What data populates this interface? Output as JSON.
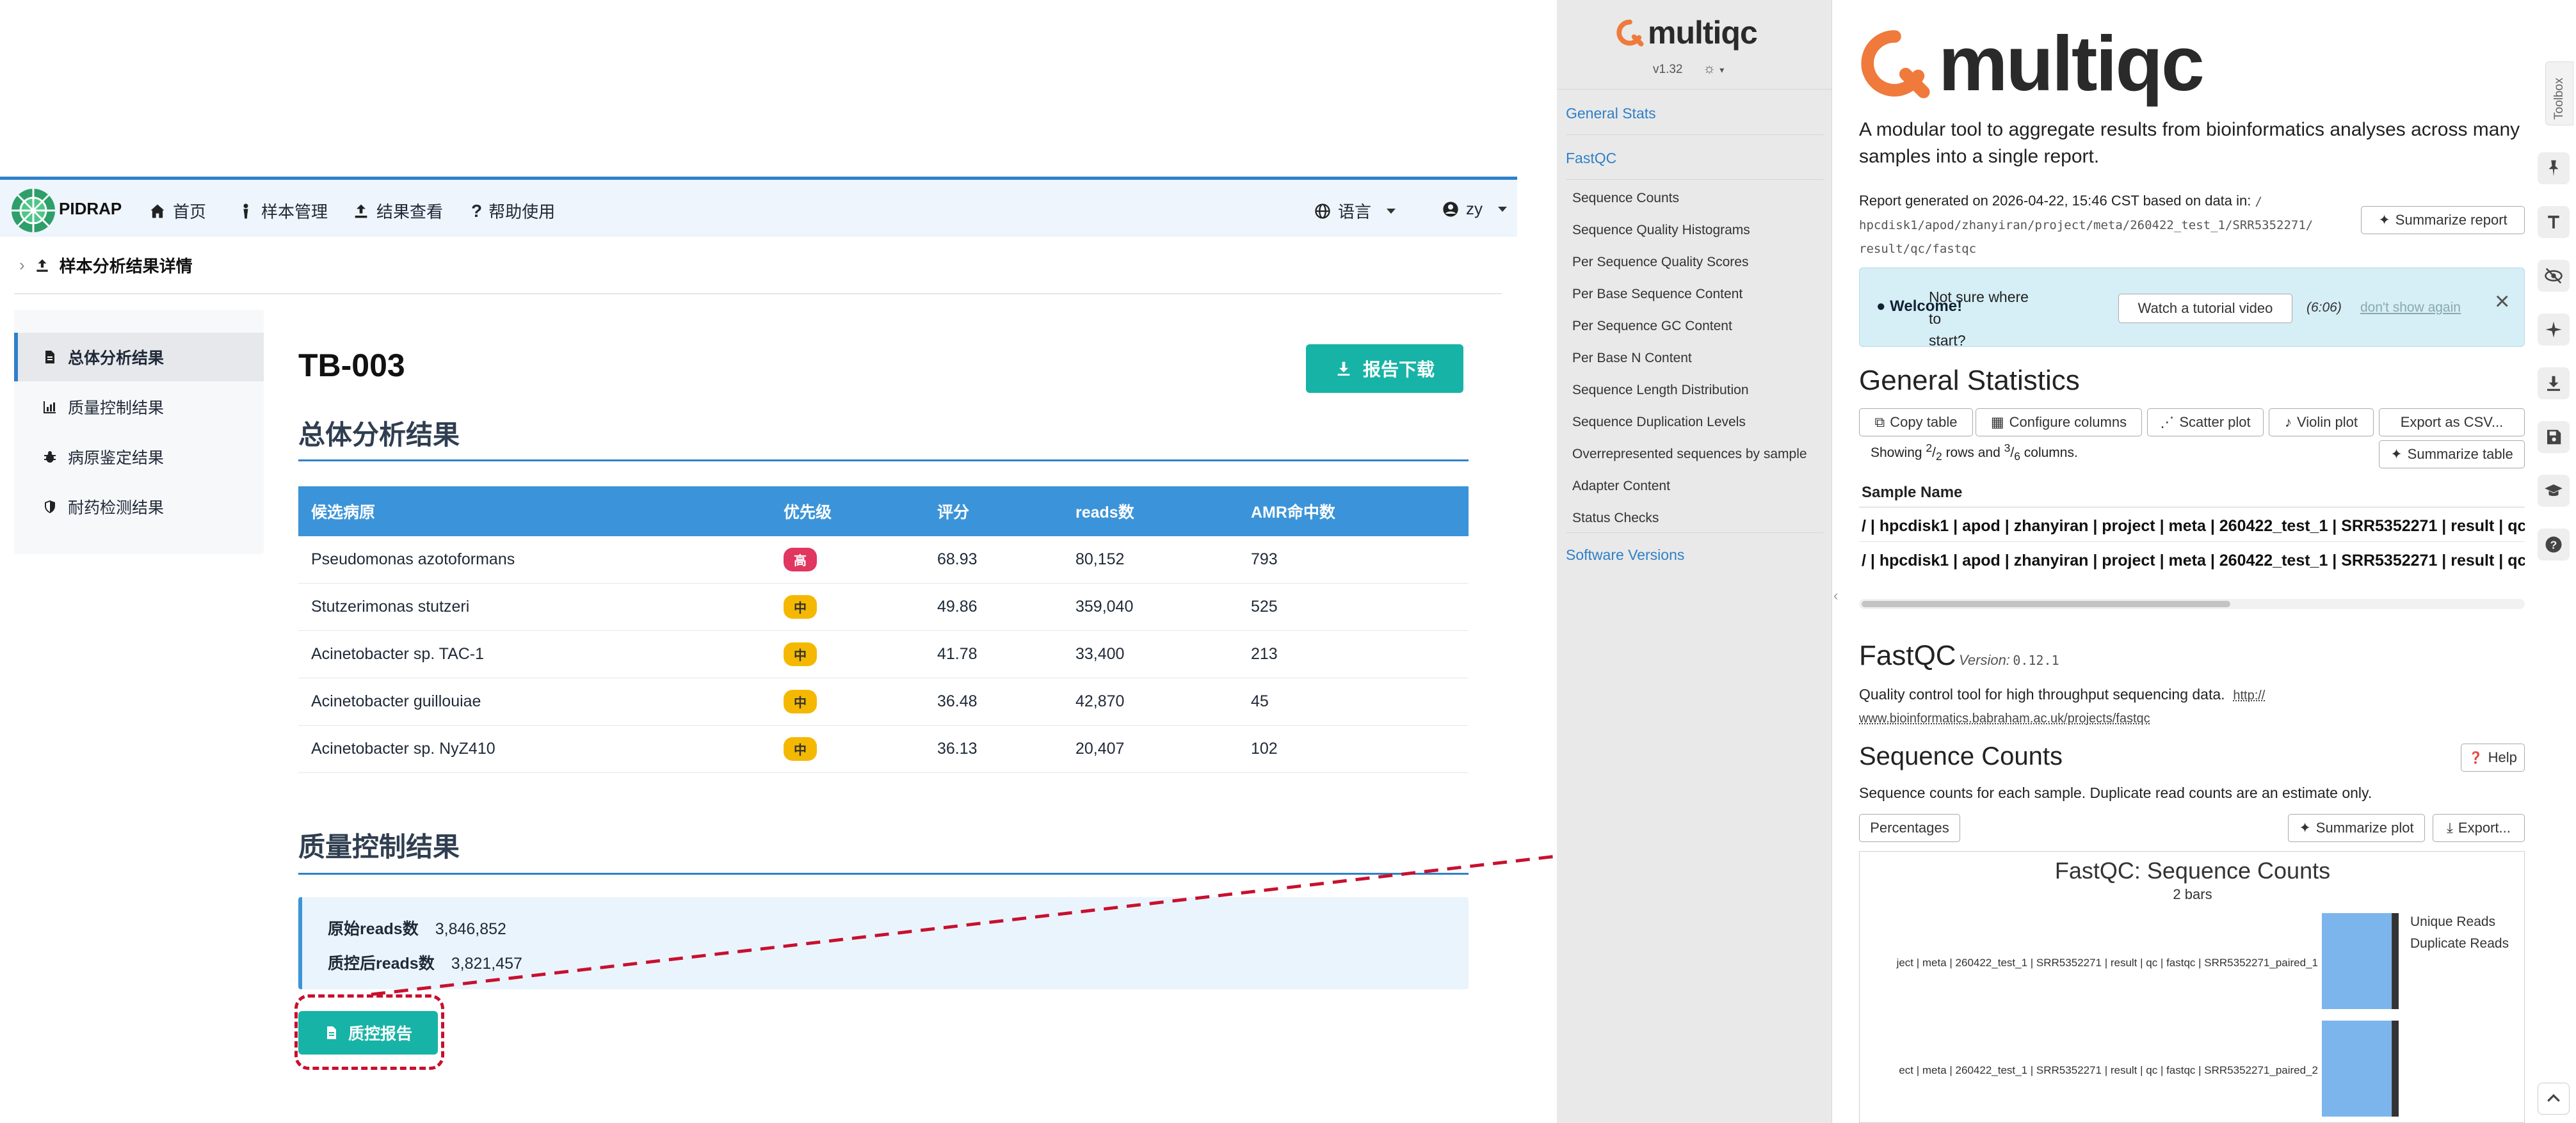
{
  "colors": {
    "accent_blue": "#2f80c8",
    "teal": "#17b3a6",
    "high": "#e0365f",
    "mid": "#f5b800",
    "multiqc_orange": "#ef7a3c",
    "highlight_red": "#c8102e"
  },
  "left": {
    "brand": "PIDRAP",
    "nav": {
      "home": "首页",
      "samples": "样本管理",
      "results": "结果查看",
      "help": "帮助使用",
      "language": "语言",
      "user": "zy"
    },
    "breadcrumb": "样本分析结果详情",
    "sidebar": [
      {
        "label": "总体分析结果",
        "icon": "document-icon",
        "active": true
      },
      {
        "label": "质量控制结果",
        "icon": "chart-icon",
        "active": false
      },
      {
        "label": "病原鉴定结果",
        "icon": "bug-icon",
        "active": false
      },
      {
        "label": "耐药检测结果",
        "icon": "shield-icon",
        "active": false
      }
    ],
    "title": "TB-003",
    "download_label": "报告下载",
    "overview_title": "总体分析结果",
    "table": {
      "headers": [
        "候选病原",
        "优先级",
        "评分",
        "reads数",
        "AMR命中数"
      ],
      "rows": [
        {
          "pathogen": "Pseudomonas azotoformans",
          "priority": "高",
          "level": "high",
          "score": "68.93",
          "reads": "80,152",
          "amr": "793"
        },
        {
          "pathogen": "Stutzerimonas stutzeri",
          "priority": "中",
          "level": "mid",
          "score": "49.86",
          "reads": "359,040",
          "amr": "525"
        },
        {
          "pathogen": "Acinetobacter sp. TAC-1",
          "priority": "中",
          "level": "mid",
          "score": "41.78",
          "reads": "33,400",
          "amr": "213"
        },
        {
          "pathogen": "Acinetobacter guillouiae",
          "priority": "中",
          "level": "mid",
          "score": "36.48",
          "reads": "42,870",
          "amr": "45"
        },
        {
          "pathogen": "Acinetobacter sp. NyZ410",
          "priority": "中",
          "level": "mid",
          "score": "36.13",
          "reads": "20,407",
          "amr": "102"
        }
      ]
    },
    "qc_title": "质量控制结果",
    "qc": {
      "raw_label": "原始reads数",
      "raw_value": "3,846,852",
      "clean_label": "质控后reads数",
      "clean_value": "3,821,457"
    },
    "qc_button": "质控报告"
  },
  "mqc": {
    "logo": "multiqc",
    "version": "v1.32",
    "toc": {
      "general": "General Stats",
      "fastqc": "FastQC",
      "subs": [
        "Sequence Counts",
        "Sequence Quality Histograms",
        "Per Sequence Quality Scores",
        "Per Base Sequence Content",
        "Per Sequence GC Content",
        "Per Base N Content",
        "Sequence Length Distribution",
        "Sequence Duplication Levels",
        "Overrepresented sequences by sample",
        "Adapter Content",
        "Status Checks"
      ],
      "software": "Software Versions"
    },
    "tagline": "A modular tool to aggregate results from bioinformatics analyses across many samples into a single report.",
    "report_gen": "Report generated on 2026-04-22, 15:46 CST based on data in:",
    "report_path_1": "/",
    "report_path_2": "hpcdisk1/apod/zhanyiran/project/meta/260422_test_1/SRR5352271/",
    "report_path_3": "result/qc/fastqc",
    "summarize_report": "Summarize report",
    "welcome": {
      "title": "Welcome!",
      "text_1": "Not sure where to",
      "text_2": "start?",
      "video": "Watch a tutorial video",
      "duration": "(6:06)",
      "dont_show": "don't show again"
    },
    "gs_title": "General Statistics",
    "gs_buttons": [
      "Copy table",
      "Configure columns",
      "Scatter plot",
      "Violin plot",
      "Export as CSV..."
    ],
    "gs_showing_1": "Showing",
    "gs_rows_num": "2",
    "gs_rows_den": "2",
    "gs_showing_2": "rows and",
    "gs_cols_num": "3",
    "gs_cols_den": "6",
    "gs_showing_3": "columns.",
    "summarize_table": "Summarize table",
    "gs_header": "Sample Name",
    "gs_rows": [
      "/ | hpcdisk1 | apod | zhanyiran | project | meta | 260422_test_1 | SRR5352271 | result | qc |",
      "/ | hpcdisk1 | apod | zhanyiran | project | meta | 260422_test_1 | SRR5352271 | result | qc |"
    ],
    "fastqc_title": "FastQC",
    "fastqc_version_label": "Version:",
    "fastqc_version": "0.12.1",
    "fastqc_desc": "Quality control tool for high throughput sequencing data.",
    "fastqc_link_1": "http://",
    "fastqc_link_2": "www.bioinformatics.babraham.ac.uk/projects/fastqc",
    "seq_title": "Sequence Counts",
    "help": "Help",
    "seq_desc": "Sequence counts for each sample. Duplicate read counts are an estimate only.",
    "percentages": "Percentages",
    "summarize_plot": "Summarize plot",
    "export": "Export...",
    "toolbox": "Toolbox"
  },
  "chart_data": {
    "type": "bar",
    "title": "FastQC: Sequence Counts",
    "subtitle": "2 bars",
    "categories": [
      "ject | meta | 260422_test_1 | SRR5352271 | result | qc | fastqc | SRR5352271_paired_1",
      "ect | meta | 260422_test_1 | SRR5352271 | result | qc | fastqc | SRR5352271_paired_2"
    ],
    "series": [
      {
        "name": "Unique Reads",
        "color": "#7cb5ec",
        "values": [
          1,
          1
        ]
      },
      {
        "name": "Duplicate Reads",
        "color": "#333333",
        "values": [
          0.1,
          0.1
        ]
      }
    ]
  }
}
